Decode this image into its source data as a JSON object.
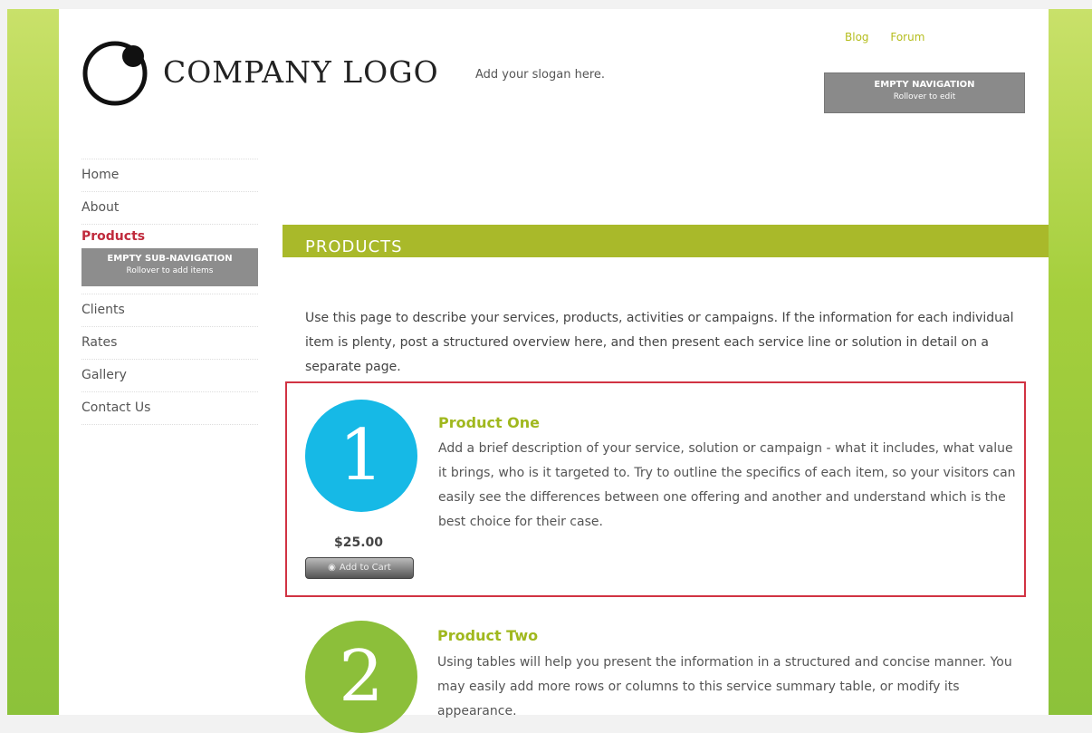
{
  "header": {
    "logo_text": "COMPANY LOGO",
    "slogan": "Add your slogan here.",
    "top_links": [
      "Blog",
      "Forum"
    ],
    "empty_nav": {
      "title": "EMPTY NAVIGATION",
      "subtitle": "Rollover to edit"
    }
  },
  "nav": {
    "items": [
      "Home",
      "About",
      "Products",
      "Clients",
      "Rates",
      "Gallery",
      "Contact Us"
    ],
    "active": "Products",
    "sub_nav": {
      "title": "EMPTY SUB-NAVIGATION",
      "subtitle": "Rollover to add items"
    }
  },
  "content": {
    "page_title": "PRODUCTS",
    "intro": "Use this page to describe your services, products, activities or campaigns. If the information for each individual item is plenty, post a structured overview here, and then present each service line or solution in detail on a separate page.",
    "products": [
      {
        "number": "1",
        "title": "Product One",
        "description": "Add a brief description of your service, solution or campaign - what it includes, what value it brings, who is it targeted to. Try to outline the specifics of each item, so your visitors can easily see the differences between one offering and another and understand which is the best choice for their case.",
        "price": "$25.00",
        "button": "Add to Cart",
        "circle_color": "#16b9e6"
      },
      {
        "number": "2",
        "title": "Product Two",
        "description": "Using tables will help you present the information in a structured and concise manner. You may easily add more rows or columns to this service summary table, or modify its appearance.",
        "circle_color": "#8cbf3a"
      }
    ]
  },
  "colors": {
    "accent_green": "#a9b92a",
    "active_red": "#c02a3c",
    "link_yellow": "#b5bd1e",
    "selection_border": "#d13343"
  }
}
